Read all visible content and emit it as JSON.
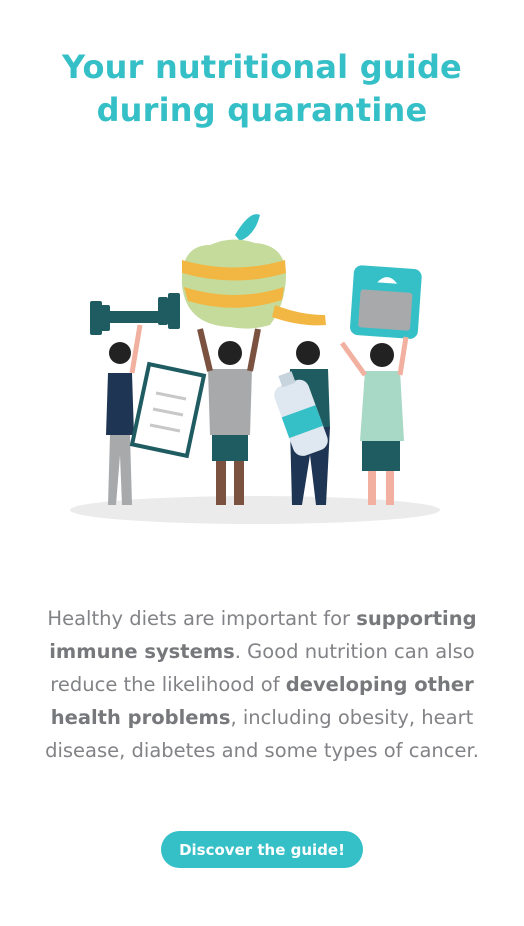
{
  "hero": {
    "title_line1": "Your nutritional guide",
    "title_line2": "during quarantine"
  },
  "description": {
    "seg1": "Healthy diets are important for ",
    "bold1": "supporting immune systems",
    "seg2": ". Good nutrition can also reduce the likelihood of ",
    "bold2": "developing other health problems",
    "seg3": ", including obesity, heart disease, diabetes and some types of cancer."
  },
  "cta": {
    "label": "Discover the guide!"
  },
  "colors": {
    "accent": "#35bfc7",
    "text": "#828386",
    "dark_teal": "#1f5c62"
  },
  "illustration": {
    "icons": [
      "apple-icon",
      "measuring-tape-icon",
      "dumbbell-icon",
      "scale-icon",
      "clipboard-icon",
      "water-bottle-icon"
    ]
  }
}
